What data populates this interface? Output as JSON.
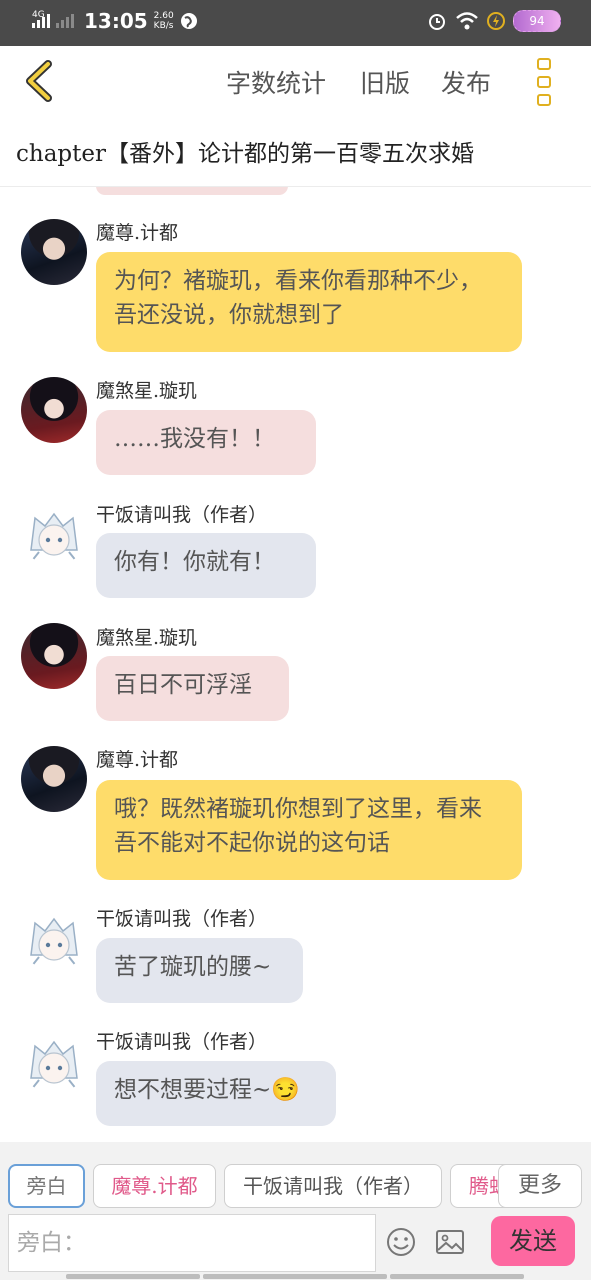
{
  "status_bar": {
    "network": "4G",
    "time": "13:05",
    "speed_value": "2.60",
    "speed_unit": "KB/s",
    "battery": "94",
    "icons": [
      "signal-icon",
      "globe-icon",
      "alarm-icon",
      "wifi-icon",
      "charging-icon",
      "battery-icon"
    ]
  },
  "header": {
    "word_count_label": "字数统计",
    "old_version_label": "旧版",
    "publish_label": "发布",
    "accent_color": "#e0b020"
  },
  "chapter_title": "chapter【番外】论计都的第一百零五次求婚",
  "messages": [
    {
      "speaker": "魔尊.计都",
      "text": "为何？褚璇玑，看来你看那种不少，吾还没说，你就想到了",
      "avatar": "avatar-jidu",
      "color": "#fedc6a"
    },
    {
      "speaker": "魔煞星.璇玑",
      "text": "……我没有！！",
      "avatar": "avatar-xuanji",
      "color": "#f5dede"
    },
    {
      "speaker": "干饭请叫我（作者）",
      "text": "你有！你就有！",
      "avatar": "avatar-author",
      "color": "#e3e6ee"
    },
    {
      "speaker": "魔煞星.璇玑",
      "text": "百日不可浮淫",
      "avatar": "avatar-xuanji",
      "color": "#f5dede"
    },
    {
      "speaker": "魔尊.计都",
      "text": "哦？既然褚璇玑你想到了这里，看来吾不能对不起你说的这句话",
      "avatar": "avatar-jidu",
      "color": "#fedc6a"
    },
    {
      "speaker": "干饭请叫我（作者）",
      "text": "苦了璇玑的腰~",
      "avatar": "avatar-author",
      "color": "#e3e6ee"
    },
    {
      "speaker": "干饭请叫我（作者）",
      "text": "想不想要过程~😏",
      "avatar": "avatar-author",
      "color": "#e3e6ee"
    }
  ],
  "role_tabs": [
    "旁白",
    "魔尊.计都",
    "干饭请叫我（作者）",
    "腾蛇"
  ],
  "more_label": "更多",
  "input": {
    "placeholder": "旁白：",
    "value": ""
  },
  "send_label": "发送",
  "send_color": "#fd68a0"
}
